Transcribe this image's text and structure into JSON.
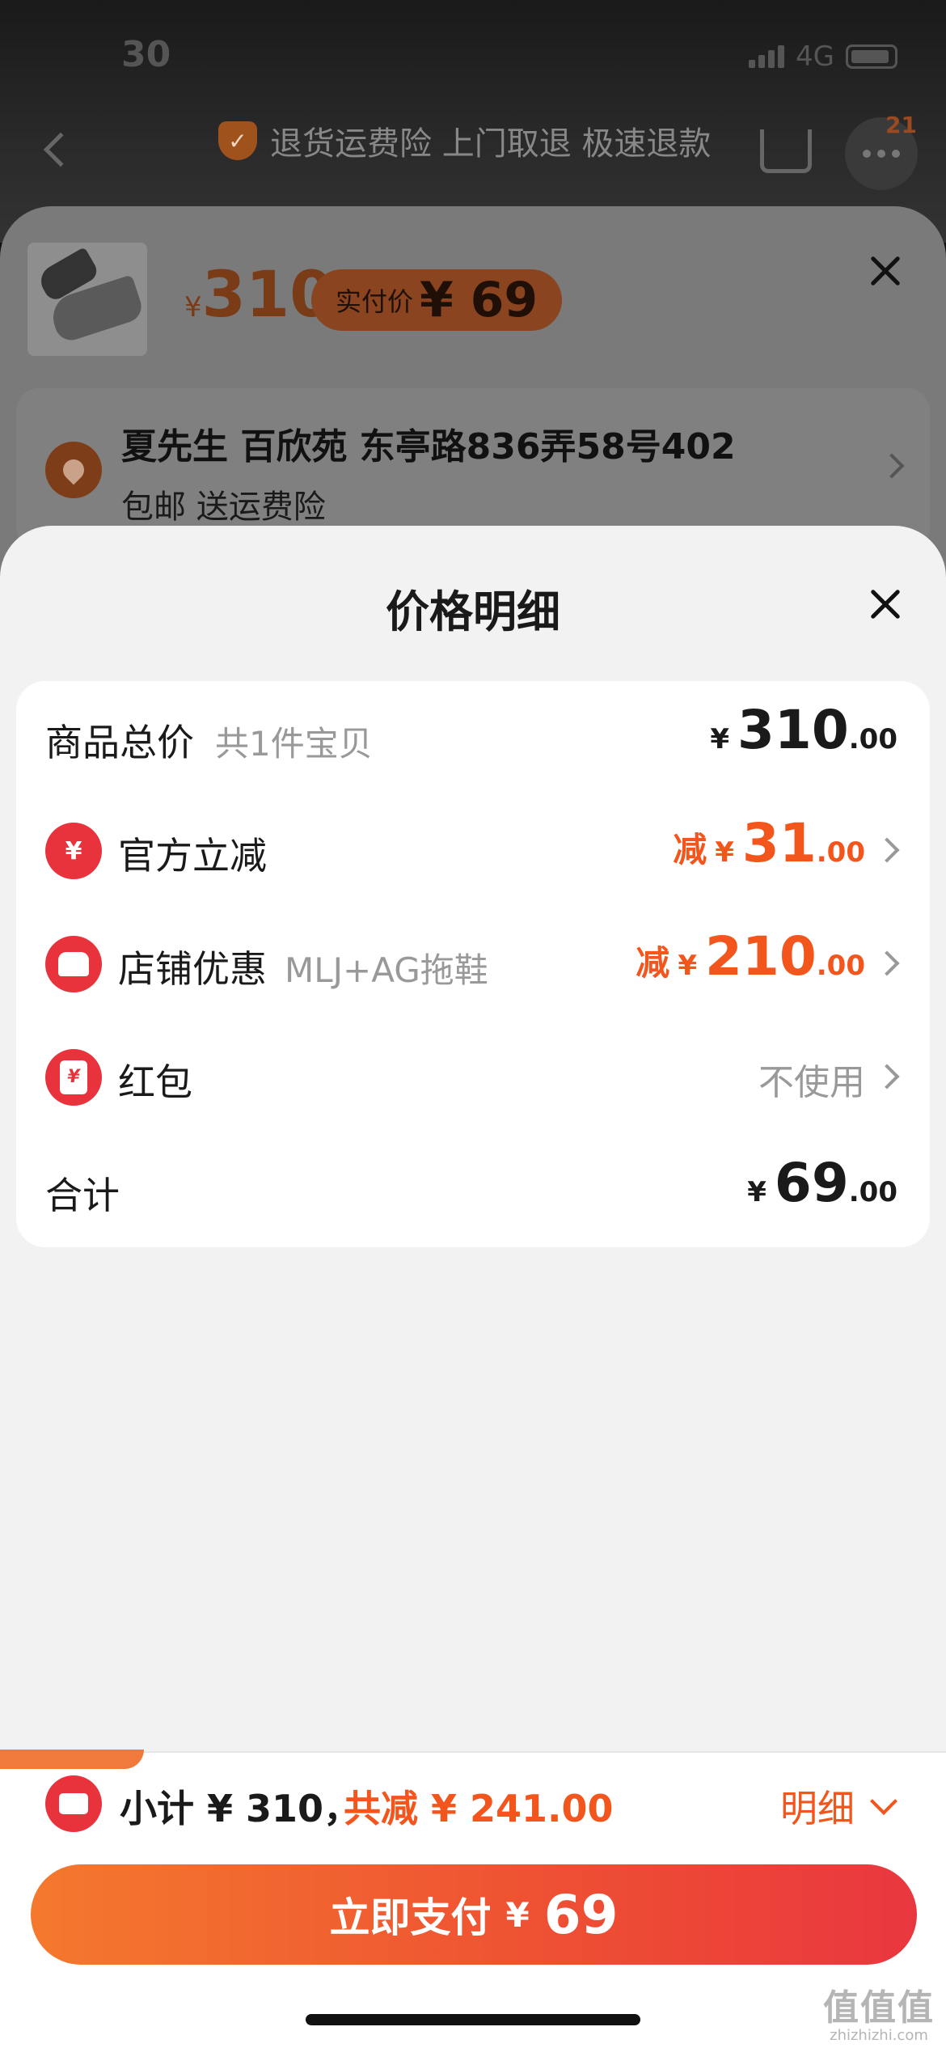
{
  "status_bar": {
    "time": "30",
    "network": "4G"
  },
  "background_page": {
    "promo_text": "退货运费险 上门取退 极速退款",
    "cart_badge": "21"
  },
  "product_sheet": {
    "currency": "¥",
    "price": "310",
    "real_price_label": "实付价",
    "real_price": "¥ 69",
    "address": "夏先生  百欣苑  东亭路836弄58号402",
    "shipping": "包邮   送运费险"
  },
  "price_detail": {
    "title": "价格明细",
    "rows": [
      {
        "label": "商品总价",
        "sub": "共1件宝贝",
        "prefix": "",
        "yen": "¥",
        "int": "310",
        "dec": ".00"
      },
      {
        "label": "官方立减",
        "sub": "",
        "prefix": "减",
        "yen": "¥",
        "int": "31",
        "dec": ".00",
        "icon": "yen-return-icon"
      },
      {
        "label": "店铺优惠",
        "sub": "MLJ+AG拖鞋",
        "prefix": "减",
        "yen": "¥",
        "int": "210",
        "dec": ".00",
        "icon": "shop-icon"
      },
      {
        "label": "红包",
        "sub": "",
        "value": "不使用",
        "icon": "red-packet-icon"
      },
      {
        "label": "合计",
        "sub": "",
        "prefix": "",
        "yen": "¥",
        "int": "69",
        "dec": ".00"
      }
    ]
  },
  "bottom_bar": {
    "subtotal": "小计 ¥ 310，",
    "saved": "共减 ¥ 241.00",
    "detail_label": "明细",
    "pay_label": "立即支付",
    "pay_yen": "¥",
    "pay_amount": "69"
  },
  "watermark": {
    "big": "值值值",
    "small": "zhizhizhi.com"
  },
  "colors": {
    "accent": "#f2561c",
    "red": "#e8323c",
    "sheet_bg": "#f2f2f2"
  }
}
